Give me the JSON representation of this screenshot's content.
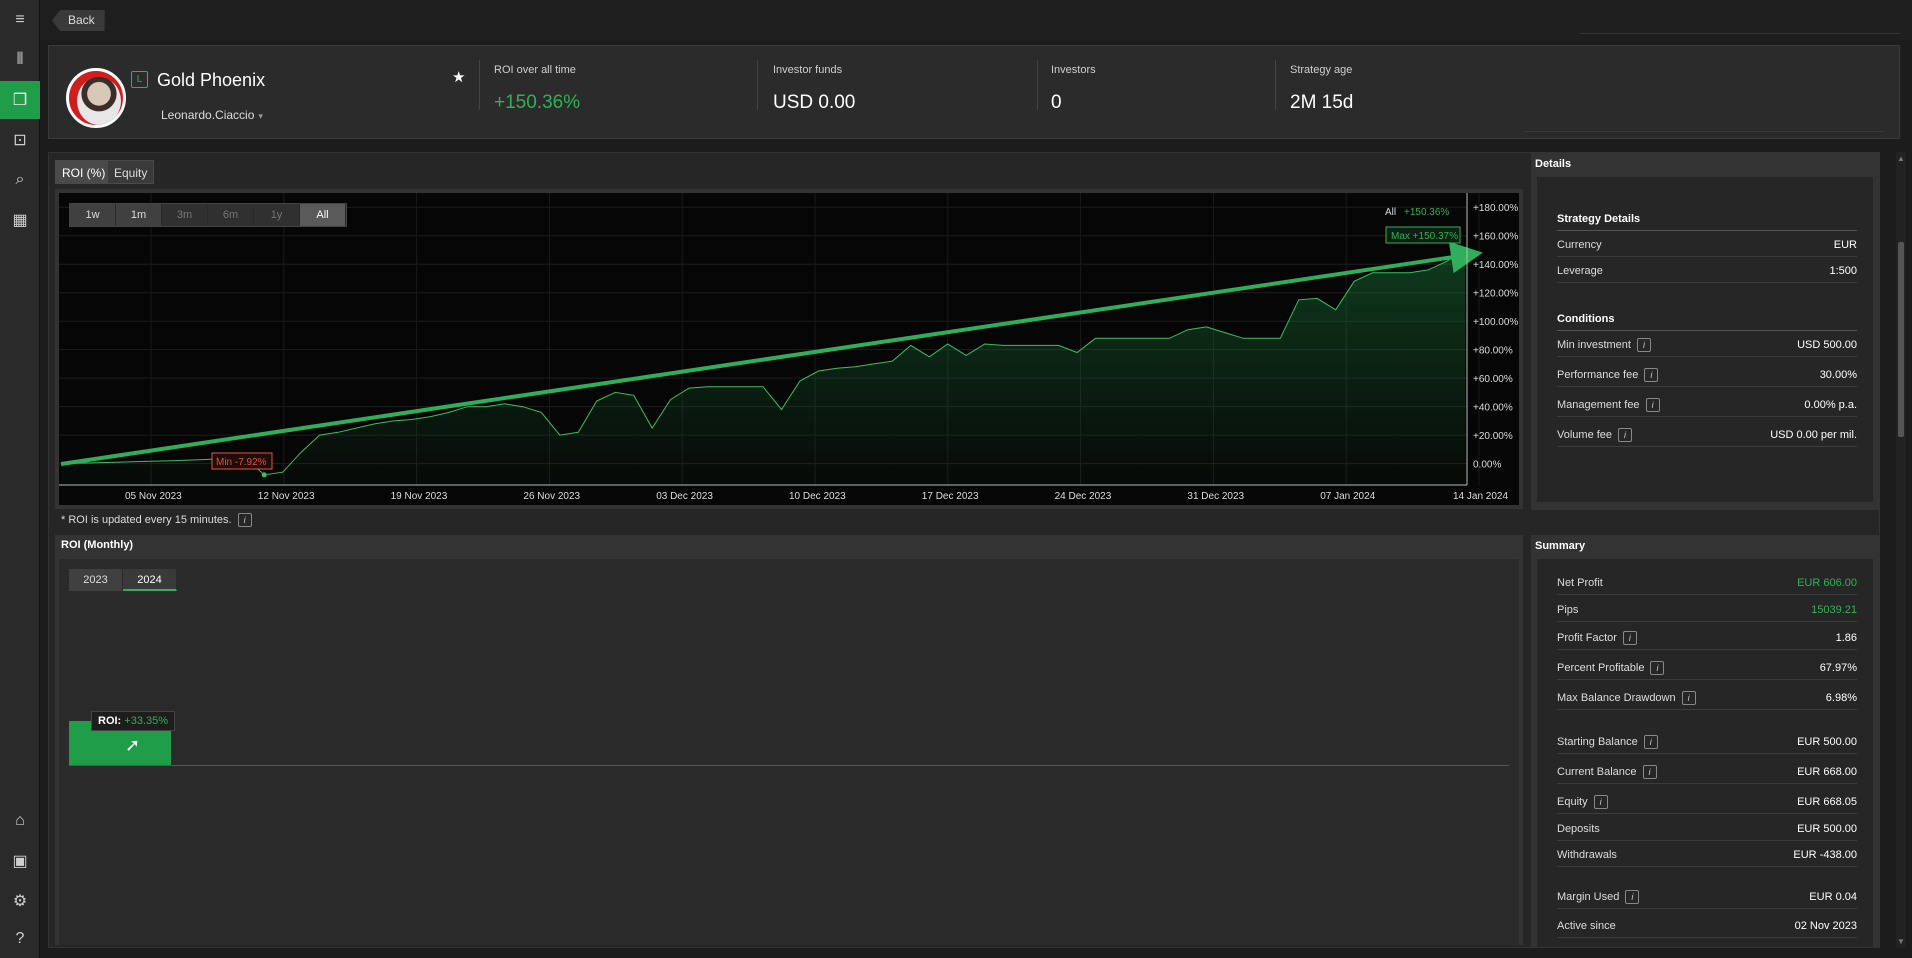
{
  "sidebar": {
    "items": [
      {
        "icon": "menu-icon",
        "glyph": "≡"
      },
      {
        "icon": "candlestick-icon",
        "glyph": "⫴"
      },
      {
        "icon": "copy-icon",
        "glyph": "❐"
      },
      {
        "icon": "robot-icon",
        "glyph": "⊡"
      },
      {
        "icon": "search-chart-icon",
        "glyph": "⌕"
      },
      {
        "icon": "dashboard-icon",
        "glyph": "▦"
      },
      {
        "icon": "store-icon",
        "glyph": "⌂"
      },
      {
        "icon": "wallet-icon",
        "glyph": "▣"
      },
      {
        "icon": "gear-icon",
        "glyph": "⚙"
      },
      {
        "icon": "help-icon",
        "glyph": "?"
      }
    ]
  },
  "back_label": "Back",
  "strategy": {
    "level_badge": "L",
    "name": "Gold Phoenix",
    "owner": "Leonardo.Ciaccio",
    "caret": "▾",
    "star": "★"
  },
  "stats": [
    {
      "label": "ROI over all time",
      "value": "+150.36%"
    },
    {
      "label": "Investor funds",
      "value": "USD 0.00"
    },
    {
      "label": "Investors",
      "value": "0"
    },
    {
      "label": "Strategy age",
      "value": "2M 15d"
    }
  ],
  "tabs": [
    "ROI (%)",
    "Equity"
  ],
  "ranges": [
    "1w",
    "1m",
    "3m",
    "6m",
    "1y",
    "All"
  ],
  "chart_data": {
    "type": "area",
    "x": [
      "05 Nov 2023",
      "12 Nov 2023",
      "19 Nov 2023",
      "26 Nov 2023",
      "03 Dec 2023",
      "10 Dec 2023",
      "17 Dec 2023",
      "24 Dec 2023",
      "31 Dec 2023",
      "07 Jan 2024",
      "14 Jan 2024"
    ],
    "y_ticks": [
      "+180.00%",
      "+160.00%",
      "+140.00%",
      "+120.00%",
      "+100.00%",
      "+80.00%",
      "+60.00%",
      "+40.00%",
      "+20.00%",
      "0.00%"
    ],
    "ylim": [
      -15,
      190
    ],
    "series": [
      {
        "points": [
          [
            0,
            0
          ],
          [
            3,
            1
          ],
          [
            6,
            2
          ],
          [
            8,
            3
          ],
          [
            10,
            4
          ],
          [
            11,
            -7.92
          ],
          [
            12,
            -6
          ],
          [
            13,
            8
          ],
          [
            14,
            20
          ],
          [
            15,
            22
          ],
          [
            16,
            25
          ],
          [
            17,
            28
          ],
          [
            18,
            30
          ],
          [
            19,
            31
          ],
          [
            20,
            33
          ],
          [
            21,
            36
          ],
          [
            22,
            40
          ],
          [
            23,
            40
          ],
          [
            24,
            42
          ],
          [
            25,
            40
          ],
          [
            26,
            36
          ],
          [
            27,
            20
          ],
          [
            28,
            22
          ],
          [
            29,
            44
          ],
          [
            30,
            50
          ],
          [
            31,
            48
          ],
          [
            32,
            25
          ],
          [
            33,
            45
          ],
          [
            34,
            53
          ],
          [
            35,
            54
          ],
          [
            36,
            54
          ],
          [
            37,
            54
          ],
          [
            38,
            54
          ],
          [
            39,
            38
          ],
          [
            40,
            58
          ],
          [
            41,
            65
          ],
          [
            42,
            67
          ],
          [
            43,
            68
          ],
          [
            44,
            70
          ],
          [
            45,
            72
          ],
          [
            46,
            83
          ],
          [
            47,
            75
          ],
          [
            48,
            84
          ],
          [
            49,
            76
          ],
          [
            50,
            84
          ],
          [
            51,
            83
          ],
          [
            52,
            83
          ],
          [
            53,
            83
          ],
          [
            54,
            83
          ],
          [
            55,
            78
          ],
          [
            56,
            88
          ],
          [
            57,
            88
          ],
          [
            58,
            88
          ],
          [
            59,
            88
          ],
          [
            60,
            88
          ],
          [
            61,
            94
          ],
          [
            62,
            96
          ],
          [
            63,
            92
          ],
          [
            64,
            88
          ],
          [
            65,
            88
          ],
          [
            66,
            88
          ],
          [
            67,
            115
          ],
          [
            68,
            116
          ],
          [
            69,
            108
          ],
          [
            70,
            128
          ],
          [
            71,
            134
          ],
          [
            72,
            134
          ],
          [
            73,
            134
          ],
          [
            74,
            136
          ],
          [
            75,
            142
          ],
          [
            76,
            150.37
          ]
        ],
        "x_max": 76
      }
    ],
    "annotations": {
      "all": "All",
      "all_value": "+150.36%",
      "max": "Max +150.37%",
      "min": "Min -7.92%"
    }
  },
  "roi_note": "* ROI is updated every 15 minutes.",
  "info_glyph": "i",
  "monthly": {
    "title": "ROI (Monthly)",
    "years": [
      "2023",
      "2024"
    ],
    "tooltip_label": "ROI:",
    "tooltip_value": "+33.35%"
  },
  "details": {
    "title": "Details",
    "strategy_header": "Strategy Details",
    "rows": [
      {
        "label": "Currency",
        "value": "EUR"
      },
      {
        "label": "Leverage",
        "value": "1:500"
      }
    ],
    "conditions_header": "Conditions",
    "conditions": [
      {
        "label": "Min investment",
        "value": "USD 500.00"
      },
      {
        "label": "Performance fee",
        "value": "30.00%"
      },
      {
        "label": "Management fee",
        "value": "0.00% p.a."
      },
      {
        "label": "Volume fee",
        "value": "USD 0.00 per mil."
      }
    ]
  },
  "summary": {
    "title": "Summary",
    "rows": [
      {
        "label": "Net Profit",
        "value": "EUR 606.00"
      },
      {
        "label": "Pips",
        "value": "15039.21"
      },
      {
        "label": "Profit Factor",
        "value": "1.86"
      },
      {
        "label": "Percent Profitable",
        "value": "67.97%"
      },
      {
        "label": "Max Balance Drawdown",
        "value": "6.98%"
      },
      {
        "label": "Starting Balance",
        "value": "EUR 500.00"
      },
      {
        "label": "Current Balance",
        "value": "EUR 668.00"
      },
      {
        "label": "Equity",
        "value": "EUR 668.05"
      },
      {
        "label": "Deposits",
        "value": "EUR 500.00"
      },
      {
        "label": "Withdrawals",
        "value": "EUR -438.00"
      },
      {
        "label": "Margin Used",
        "value": "EUR 0.04"
      },
      {
        "label": "Active since",
        "value": "02 Nov 2023"
      }
    ]
  },
  "colors": {
    "accent": "#1f9d48",
    "positive": "#2fb255",
    "loss": "#e0533d"
  }
}
